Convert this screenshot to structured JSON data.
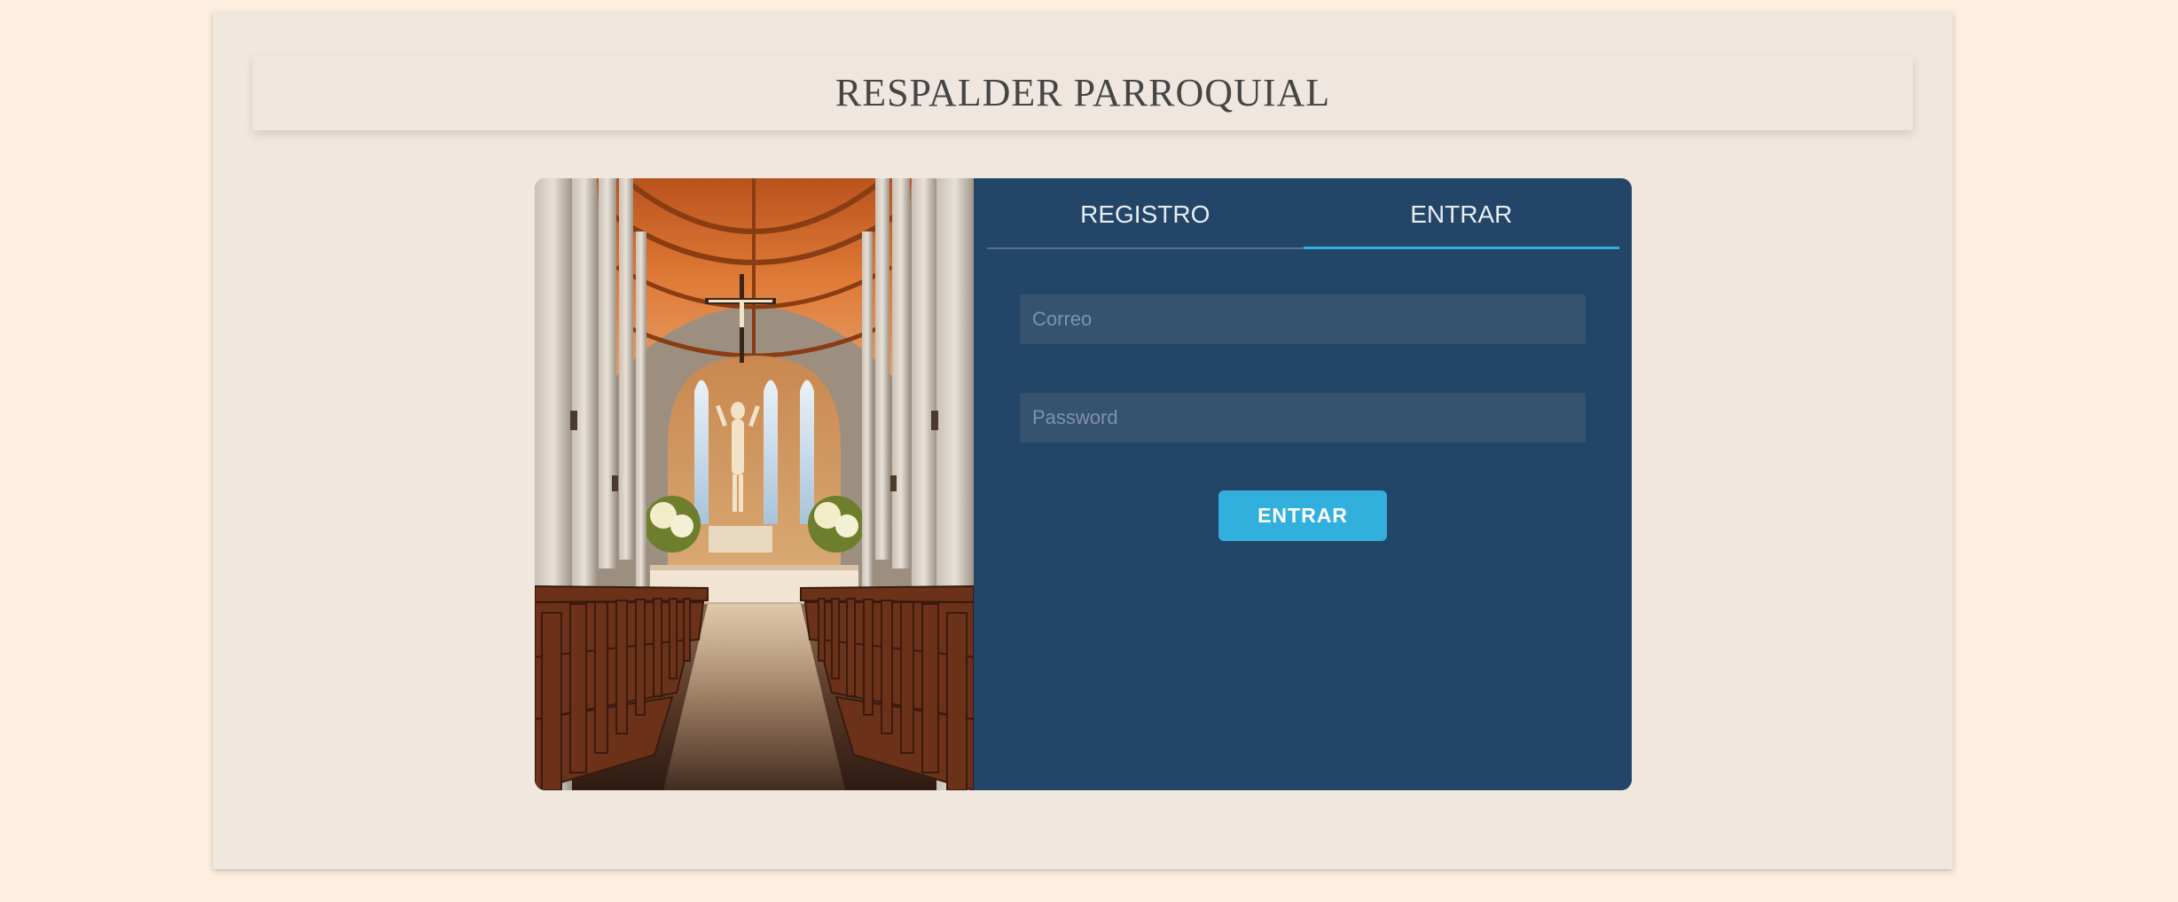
{
  "header": {
    "title": "RESPALDER PARROQUIAL"
  },
  "login": {
    "tabs": [
      {
        "label": "REGISTRO",
        "active": false
      },
      {
        "label": "ENTRAR",
        "active": true
      }
    ],
    "email_placeholder": "Correo",
    "password_placeholder": "Password",
    "submit_label": "ENTRAR"
  },
  "image": {
    "subject": "church-interior-photo"
  },
  "colors": {
    "page_background": "#fdeee0",
    "card_background": "#f0e7df",
    "form_panel": "#234567",
    "input_background": "#35526f",
    "accent": "#31b0dd"
  }
}
